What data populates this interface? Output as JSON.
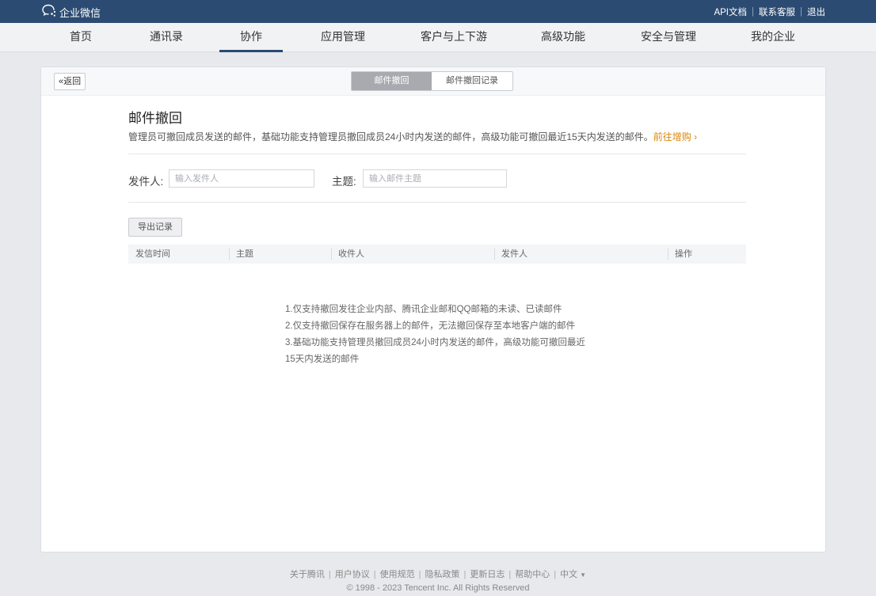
{
  "topbar": {
    "brand": "企业微信",
    "links": [
      "API文档",
      "联系客服",
      "退出"
    ]
  },
  "nav": {
    "items": [
      "首页",
      "通讯录",
      "协作",
      "应用管理",
      "客户与上下游",
      "高级功能",
      "安全与管理",
      "我的企业"
    ],
    "active": "协作"
  },
  "card": {
    "back_label": "返回",
    "tabs": [
      "邮件撤回",
      "邮件撤回记录"
    ],
    "active_tab": "邮件撤回"
  },
  "page": {
    "title": "邮件撤回",
    "description": "管理员可撤回成员发送的邮件，基础功能支持管理员撤回成员24小时内发送的邮件，高级功能可撤回最近15天内发送的邮件。",
    "upgrade_link": "前往增购"
  },
  "filters": {
    "sender_label": "发件人:",
    "sender_placeholder": "输入发件人",
    "subject_label": "主题:",
    "subject_placeholder": "输入邮件主题"
  },
  "export_label": "导出记录",
  "table": {
    "columns": [
      "发信时间",
      "主题",
      "收件人",
      "发件人",
      "操作"
    ]
  },
  "notes": [
    "1.仅支持撤回发往企业内部、腾讯企业邮和QQ邮箱的未读、已读邮件",
    "2.仅支持撤回保存在服务器上的邮件，无法撤回保存至本地客户端的邮件",
    "3.基础功能支持管理员撤回成员24小时内发送的邮件，高级功能可撤回最近15天内发送的邮件"
  ],
  "footer": {
    "links": [
      "关于腾讯",
      "用户协议",
      "使用规范",
      "隐私政策",
      "更新日志",
      "帮助中心"
    ],
    "language": "中文",
    "copyright": "© 1998 - 2023 Tencent Inc. All Rights Reserved"
  },
  "colors": {
    "topbar": "#2b4b72",
    "accent_link": "#d8870d",
    "active_segment": "#a7aaaf"
  }
}
